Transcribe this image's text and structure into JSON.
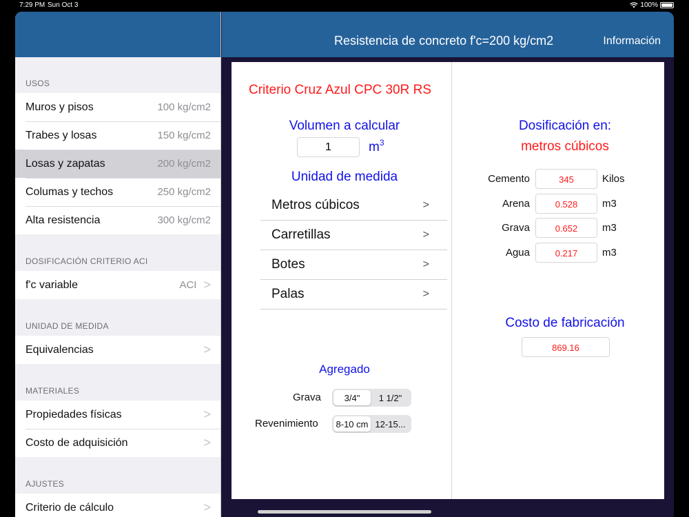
{
  "status": {
    "time": "7:29 PM",
    "date": "Sun Oct 3",
    "battery": "100%"
  },
  "nav": {
    "title": "Resistencia de concreto f'c=200 kg/cm2",
    "info": "Información"
  },
  "sidebar": {
    "usos_title": "USOS",
    "usos": [
      {
        "label": "Muros y pisos",
        "value": "100 kg/cm2"
      },
      {
        "label": "Trabes y losas",
        "value": "150 kg/cm2"
      },
      {
        "label": "Losas y zapatas",
        "value": "200 kg/cm2"
      },
      {
        "label": "Columas y techos",
        "value": "250 kg/cm2"
      },
      {
        "label": "Alta resistencia",
        "value": "300 kg/cm2"
      }
    ],
    "aci_title": "DOSIFICACIÓN CRITERIO ACI",
    "aci": {
      "label": "f'c variable",
      "value": "ACI"
    },
    "um_title": "UNIDAD DE MEDIDA",
    "um": {
      "label": "Equivalencias"
    },
    "mat_title": "MATERIALES",
    "materiales": [
      {
        "label": "Propiedades físicas"
      },
      {
        "label": "Costo de adquisición"
      }
    ],
    "ajustes_title": "AJUSTES",
    "ajustes": {
      "label": "Criterio de cálculo"
    },
    "chevron": ">"
  },
  "main": {
    "criterio": "Criterio Cruz Azul CPC 30R RS",
    "volumen_title": "Volumen a calcular",
    "volumen_value": "1",
    "volumen_unit": "m",
    "volumen_unit_exp": "3",
    "unidad_title": "Unidad de medida",
    "unidades": [
      {
        "label": "Metros cúbicos"
      },
      {
        "label": "Carretillas"
      },
      {
        "label": "Botes"
      },
      {
        "label": "Palas"
      }
    ],
    "chevron": ">",
    "agregado_title": "Agregado",
    "grava_label": "Grava",
    "grava_options": [
      "3/4\"",
      "1 1/2\""
    ],
    "revenimiento_label": "Revenimiento",
    "revenimiento_options": [
      "8-10 cm",
      "12-15..."
    ],
    "dosificacion_title": "Dosificación en:",
    "dosificacion_sub": "metros cúbicos",
    "materials": [
      {
        "label": "Cemento",
        "value": "345",
        "unit": "Kilos"
      },
      {
        "label": "Arena",
        "value": "0.528",
        "unit": "m3"
      },
      {
        "label": "Grava",
        "value": "0.652",
        "unit": "m3"
      },
      {
        "label": "Agua",
        "value": "0.217",
        "unit": "m3"
      }
    ],
    "costo_title": "Costo de fabricación",
    "costo_value": "869.16"
  },
  "colors": {
    "navbar": "#25629a",
    "red": "#ff1a1a",
    "blue": "#1212e6",
    "selected_row": "#d1d1d6"
  }
}
